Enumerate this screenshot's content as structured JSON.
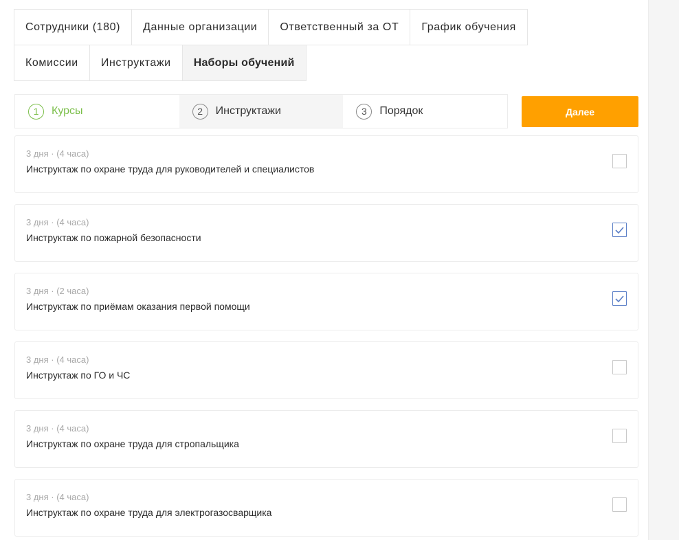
{
  "tabs_row1": [
    {
      "label": "Сотрудники (180)"
    },
    {
      "label": "Данные организации"
    },
    {
      "label": "Ответственный за ОТ"
    },
    {
      "label": "График обучения"
    }
  ],
  "tabs_row2": [
    {
      "label": "Комиссии"
    },
    {
      "label": "Инструктажи"
    },
    {
      "label": "Наборы обучений",
      "active": true
    }
  ],
  "stepper": [
    {
      "num": "1",
      "label": "Курсы",
      "state": "done"
    },
    {
      "num": "2",
      "label": "Инструктажи",
      "state": "current"
    },
    {
      "num": "3",
      "label": "Порядок",
      "state": "pending"
    }
  ],
  "next_button": "Далее",
  "colors": {
    "accent": "#ffa000",
    "done": "#7cbf4b",
    "checkbox_checked": "#5b7fc7"
  },
  "items": [
    {
      "meta": "3 дня · (4 часа)",
      "title": "Инструктаж по охране труда для руководителей и специалистов",
      "checked": false
    },
    {
      "meta": "3 дня · (4 часа)",
      "title": "Инструктаж по пожарной безопасности",
      "checked": true
    },
    {
      "meta": "3 дня · (2 часа)",
      "title": "Инструктаж по приёмам оказания первой помощи",
      "checked": true
    },
    {
      "meta": "3 дня · (4 часа)",
      "title": "Инструктаж по ГО и ЧС",
      "checked": false
    },
    {
      "meta": "3 дня · (4 часа)",
      "title": "Инструктаж по охране труда для стропальщика",
      "checked": false
    },
    {
      "meta": "3 дня · (4 часа)",
      "title": "Инструктаж по охране труда для электрогазосварщика",
      "checked": false
    }
  ]
}
